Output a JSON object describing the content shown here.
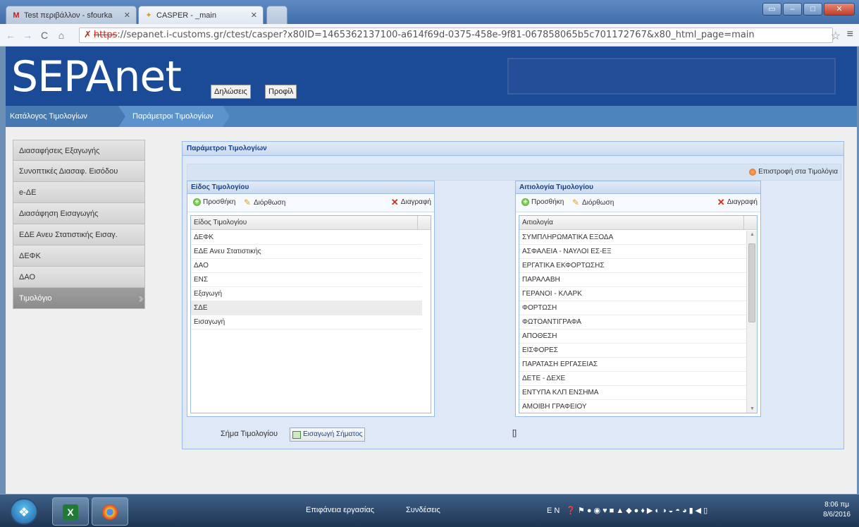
{
  "browser": {
    "tabs": [
      {
        "title": "Test περιβάλλον - sfourka",
        "icon": "gmail-icon"
      },
      {
        "title": "CASPER - _main",
        "icon": "casper-icon"
      }
    ],
    "url_prefix": "https",
    "url_rest": "://sepanet.i-customs.gr/ctest/casper?x80ID=1465362137100-a614f69d-0375-458e-9f81-067858065b5c701172767&x80_html_page=main"
  },
  "app": {
    "logo": "SEPAnet",
    "nav": {
      "declarations": "Δηλώσεις",
      "profile": "Προφίλ"
    },
    "breadcrumb": [
      "Κατάλογος Τιμολογίων",
      "Παράμετροι Τιμολογίων"
    ]
  },
  "sidebar": {
    "items": [
      {
        "label": "Διασαφήσεις Εξαγωγής"
      },
      {
        "label": "Συνοπτικές Διασαφ. Εισόδου"
      },
      {
        "label": "e-ΔΕ"
      },
      {
        "label": "Διασάφηση Εισαγωγής"
      },
      {
        "label": "ΕΔΕ Ανευ Στατιστικής Εισαγ."
      },
      {
        "label": "ΔΕΦΚ"
      },
      {
        "label": "ΔΑΟ"
      },
      {
        "label": "Τιμολόγιο"
      }
    ]
  },
  "panel": {
    "title": "Παράμετροι Τιμολογίων",
    "back_link": "Επιστροφή στα Τιμολόγια",
    "left_grid": {
      "title": "Είδος Τιμολογίου",
      "add": "Προσθήκη",
      "edit": "Διόρθωση",
      "delete": "Διαγραφή",
      "column": "Είδος Τιμολογίου",
      "rows": [
        "ΔΕΦΚ",
        "ΕΔΕ Ανευ Στατιστικής",
        "ΔΑΟ",
        "ΕΝΣ",
        "Εξαγωγή",
        "ΣΔΕ",
        "Εισαγωγή"
      ]
    },
    "right_grid": {
      "title": "Αιτιολογία Τιμολογίου",
      "add": "Προσθήκη",
      "edit": "Διόρθωση",
      "delete": "Διαγραφή",
      "column": "Αιτιολογία",
      "rows": [
        "ΣΥΜΠΛΗΡΩΜΑΤΙΚΑ ΕΞΟΔΑ",
        "ΑΣΦΑΛΕΙΑ - ΝΑΥΛΟΙ ΕΣ-ΕΞ",
        "ΕΡΓΑΤΙΚΑ ΕΚΦΟΡΤΩΣΗΣ",
        "ΠΑΡΑΛΑΒΗ",
        "ΓΕΡΑΝΟΙ - ΚΛΑΡΚ",
        "ΦΟΡΤΩΣΗ",
        "ΦΩΤΟΑΝΤΙΓΡΑΦΑ",
        "ΑΠΟΘΕΣΗ",
        "ΕΙΣΦΟΡΕΣ",
        "ΠΑΡΑΤΑΣΗ ΕΡΓΑΣΕΙΑΣ",
        "ΔΕΤΕ - ΔΕΧΕ",
        "ΕΝΤΥΠΑ ΚΛΠ ΕΝΣΗΜΑ",
        "ΑΜΟΙΒΗ ΓΡΑΦΕΙΟΥ"
      ]
    },
    "sign_label": "Σήμα Τιμολογίου",
    "sign_button": "Εισαγωγή Σήματος",
    "sign_value": "[]"
  },
  "taskbar": {
    "desktop": "Επιφάνεια εργασίας",
    "links": "Συνδέσεις",
    "lang": "EN",
    "time": "8:06 πμ",
    "date": "8/6/2016"
  }
}
